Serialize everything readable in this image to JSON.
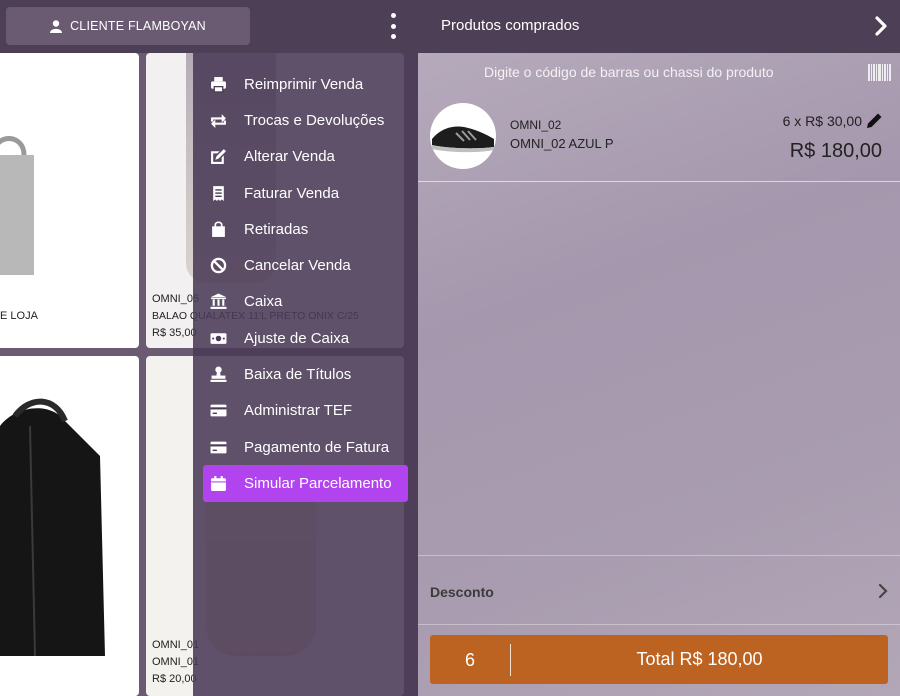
{
  "header": {
    "client_label": "CLIENTE FLAMBOYAN",
    "cart_title": "Produtos comprados"
  },
  "products": [
    {
      "code": "",
      "name": "E LOJA",
      "price": ""
    },
    {
      "code": "OMNI_05",
      "name": "BALAO QUALATEX 11'L PRETO ONIX C/25",
      "price": "R$ 35,00"
    },
    {
      "code": "",
      "name": "",
      "price": ""
    },
    {
      "code": "OMNI_01",
      "name": "OMNI_01",
      "price": "R$ 20,00"
    }
  ],
  "menu": {
    "items": [
      {
        "label": "Reimprimir Venda",
        "icon": "printer-icon"
      },
      {
        "label": "Trocas e Devoluções",
        "icon": "exchange-icon"
      },
      {
        "label": "Alterar Venda",
        "icon": "edit-icon"
      },
      {
        "label": "Faturar Venda",
        "icon": "receipt-icon"
      },
      {
        "label": "Retiradas",
        "icon": "bag-icon"
      },
      {
        "label": "Cancelar Venda",
        "icon": "ban-icon"
      },
      {
        "label": "Caixa",
        "icon": "bank-icon"
      },
      {
        "label": "Ajuste de Caixa",
        "icon": "money-icon"
      },
      {
        "label": "Baixa de Títulos",
        "icon": "stamp-icon"
      },
      {
        "label": "Administrar TEF",
        "icon": "card-icon"
      },
      {
        "label": "Pagamento de Fatura",
        "icon": "card-icon"
      },
      {
        "label": "Simular Parcelamento",
        "icon": "calendar-icon"
      }
    ],
    "active_index": 11,
    "active_color": "#b244f0"
  },
  "cart": {
    "search_placeholder": "Digite o código de barras ou chassi do produto",
    "items": [
      {
        "code": "OMNI_02",
        "description": "OMNI_02 AZUL P",
        "qty_price": "6 x R$ 30,00",
        "total": "R$ 180,00"
      }
    ],
    "discount_label": "Desconto",
    "total_qty": "6",
    "total_label": "Total R$ 180,00",
    "total_color": "#bd6321"
  }
}
